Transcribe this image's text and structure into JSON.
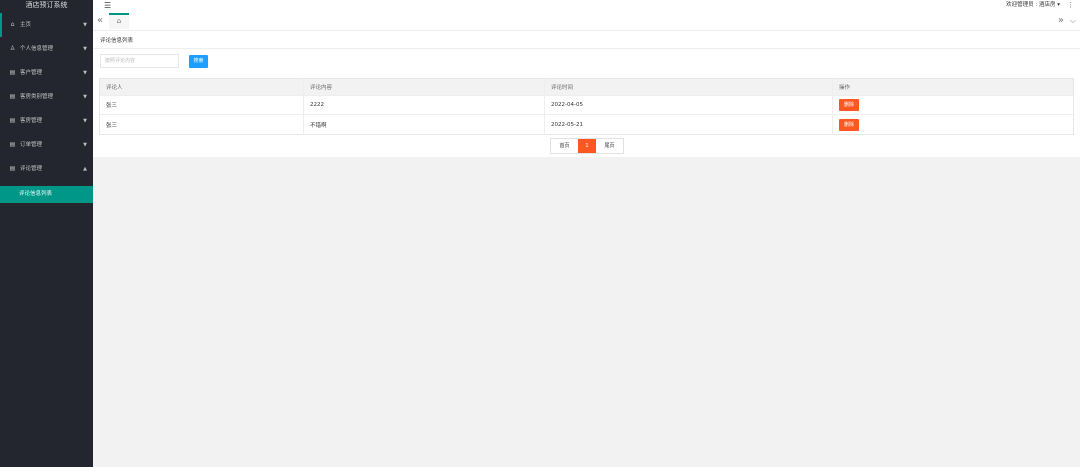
{
  "app": {
    "title": "酒店预订系统"
  },
  "sidebar": {
    "items": [
      {
        "label": "主页",
        "icon": "home-icon"
      },
      {
        "label": "个人信息管理",
        "icon": "user-icon"
      },
      {
        "label": "客户管理",
        "icon": "list-icon"
      },
      {
        "label": "客房类别管理",
        "icon": "list-icon"
      },
      {
        "label": "客房管理",
        "icon": "list-icon"
      },
      {
        "label": "订单管理",
        "icon": "list-icon"
      },
      {
        "label": "评论管理",
        "icon": "list-icon"
      }
    ],
    "sub_item": {
      "label": "评论信息列表"
    }
  },
  "header": {
    "user_label": "欢迎管理员 :",
    "user_name": "酒店房"
  },
  "breadcrumb": "评论信息列表",
  "search": {
    "placeholder": "按照评论内容",
    "button_label": "搜索"
  },
  "table": {
    "headers": [
      "评论人",
      "评论内容",
      "评论时间",
      "操作"
    ],
    "rows": [
      {
        "user": "张三",
        "content": "2222",
        "time": "2022-04-05",
        "action": "删除"
      },
      {
        "user": "张三",
        "content": "不错啊",
        "time": "2022-05-21",
        "action": "删除"
      }
    ]
  },
  "pagination": {
    "first": "首页",
    "current": "1",
    "last": "尾页"
  },
  "colors": {
    "sidebar_bg": "#23262e",
    "accent": "#009688",
    "primary": "#1e9fff",
    "danger": "#ff5722"
  }
}
